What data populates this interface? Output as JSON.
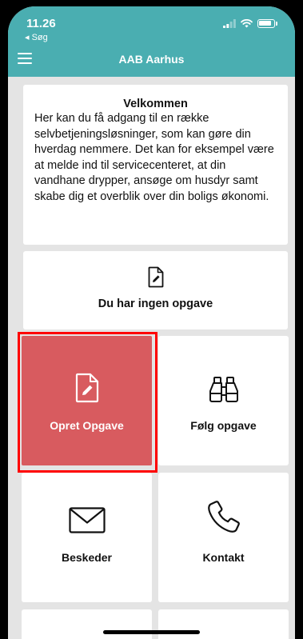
{
  "status": {
    "time": "11.26",
    "back_label": "◂ Søg",
    "icons": [
      "signal-icon",
      "wifi-icon",
      "battery-icon"
    ]
  },
  "header": {
    "title": "AAB Aarhus",
    "menu_icon": "hamburger-icon"
  },
  "welcome": {
    "title": "Velkommen",
    "text": "Her kan du få adgang til en række selvbetjeningsløsninger, som kan gøre din hverdag nemmere. Det kan for eksempel være at melde ind til servicecenteret, at din vandhane drypper, ansøge om husdyr samt skabe dig et overblik over din boligs økonomi."
  },
  "tasks": {
    "label": "Du har ingen opgave",
    "icon": "document-edit-icon"
  },
  "tiles": [
    {
      "label": "Opret Opgave",
      "icon": "document-edit-icon",
      "color": "#d85b5f",
      "highlighted": true
    },
    {
      "label": "Følg opgave",
      "icon": "binoculars-icon"
    },
    {
      "label": "Beskeder",
      "icon": "envelope-icon"
    },
    {
      "label": "Kontakt",
      "icon": "phone-icon"
    }
  ],
  "colors": {
    "header": "#4aaeb1",
    "background": "#e4e4e4",
    "accent_tile": "#d85b5f",
    "highlight_border": "#ff0000"
  }
}
